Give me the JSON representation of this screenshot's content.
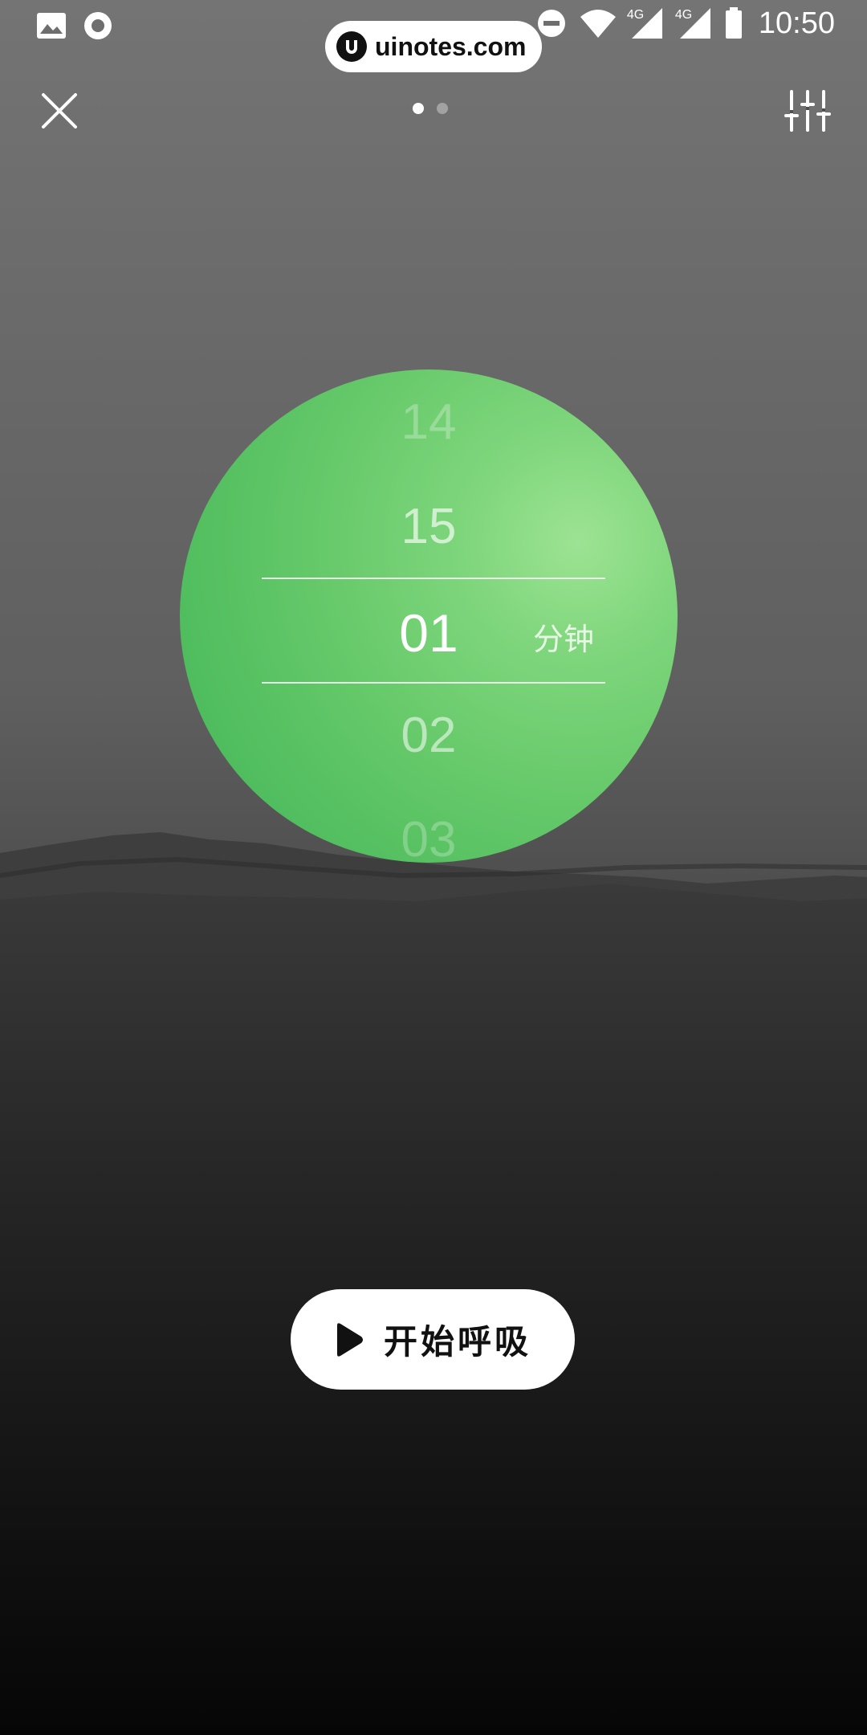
{
  "status_bar": {
    "time": "10:50",
    "network_1": "4G",
    "network_2": "4G",
    "icons": [
      "image-icon",
      "record-icon",
      "dnd-icon",
      "wifi-icon",
      "signal-icon",
      "signal-icon",
      "battery-icon"
    ]
  },
  "watermark": {
    "text": "uinotes.com"
  },
  "toolbar": {
    "close_icon": "close-icon",
    "settings_icon": "sliders-icon",
    "page_count": 2,
    "active_page": 1
  },
  "picker": {
    "items": [
      "14",
      "15",
      "01",
      "02",
      "03"
    ],
    "selected": "01",
    "unit": "分钟",
    "colors": {
      "circle_light": "#9de393",
      "circle_dark": "#46b657"
    }
  },
  "start_button": {
    "label": "开始呼吸",
    "icon": "play-icon"
  }
}
